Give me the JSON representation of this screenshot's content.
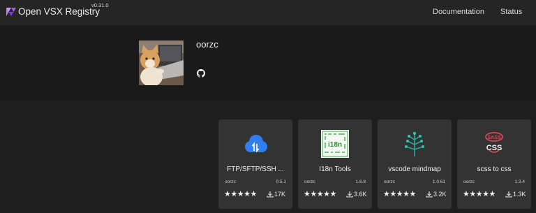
{
  "header": {
    "brand": "Open VSX Registry",
    "version": "v0.31.0",
    "nav": [
      "Documentation",
      "Status"
    ]
  },
  "publisher": {
    "name": "oorzc"
  },
  "extensions": [
    {
      "title": "FTP/SFTP/SSH ...",
      "publisher": "oorzc",
      "version": "0.5.1",
      "stars": "★★★★★",
      "downloads": "17K",
      "icon": "cloud-sync-icon"
    },
    {
      "title": "I18n Tools",
      "publisher": "oorzc",
      "version": "1.6.8",
      "stars": "★★★★★",
      "downloads": "3.6K",
      "icon": "i18n-icon"
    },
    {
      "title": "vscode mindmap",
      "publisher": "oorzc",
      "version": "1.0.61",
      "stars": "★★★★★",
      "downloads": "3.2K",
      "icon": "mindmap-tree-icon"
    },
    {
      "title": "scss to css",
      "publisher": "oorzc",
      "version": "1.3.4",
      "stars": "★★★★★",
      "downloads": "1.3K",
      "icon": "sass-icon"
    }
  ],
  "colors": {
    "accent": "#a060f0",
    "cloud": "#2f7ff2",
    "tree": "#27a8a0",
    "sass": "#d04a57"
  }
}
